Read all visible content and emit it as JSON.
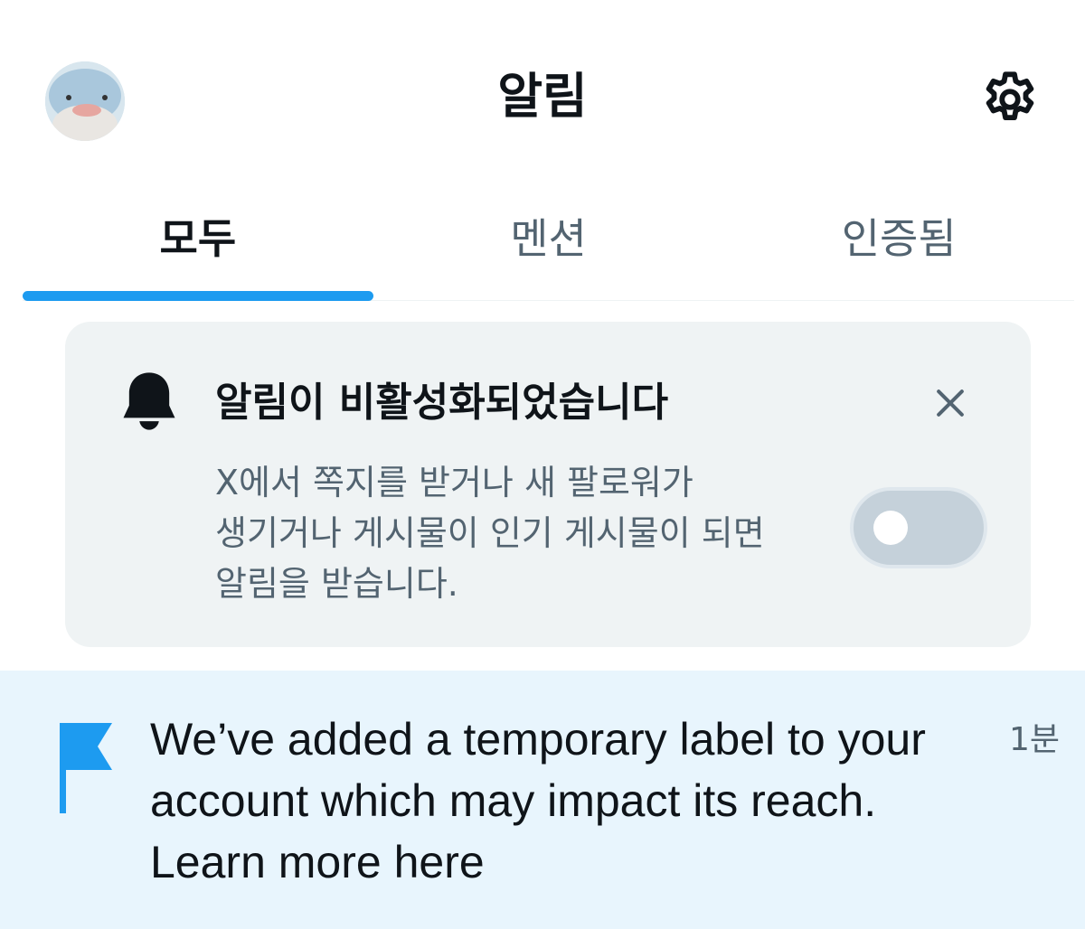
{
  "header": {
    "title": "알림",
    "avatar_icon": "dolphin-plush-avatar",
    "settings_icon": "gear-icon"
  },
  "tabs": [
    {
      "label": "모두",
      "active": true
    },
    {
      "label": "멘션",
      "active": false
    },
    {
      "label": "인증됨",
      "active": false
    }
  ],
  "banner": {
    "icon": "bell-icon",
    "title": "알림이 비활성화되었습니다",
    "body_lines": [
      "X에서 쪽지를 받거나 새 팔로워가",
      "생기거나 게시물이 인기 게시물이 되면",
      "알림을 받습니다."
    ],
    "toggle_on": false,
    "close_icon": "close-icon"
  },
  "notification": {
    "icon": "flag-icon",
    "lines": [
      "We’ve added a temporary label to your",
      "account which may impact its reach.",
      "Learn more here"
    ],
    "time": "1분"
  },
  "colors": {
    "accent": "#1d9bf0",
    "text_primary": "#0f1419",
    "text_secondary": "#536471",
    "card_background": "#eff3f4",
    "notification_background": "#e8f5fd"
  }
}
